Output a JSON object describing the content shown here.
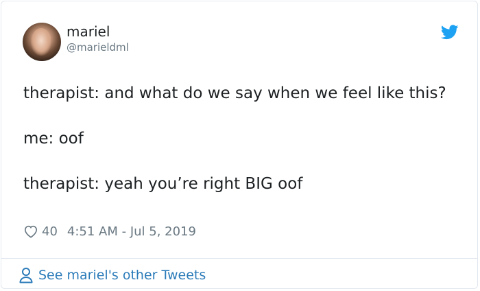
{
  "author": {
    "name": "mariel",
    "handle": "@marieldml"
  },
  "tweet": {
    "paragraphs": [
      "therapist: and what do we say when we feel like this?",
      "me: oof",
      "therapist: yeah you’re right BIG oof"
    ],
    "like_count": "40",
    "timestamp": "4:51 AM - Jul 5, 2019"
  },
  "footer": {
    "link_label": "See mariel's other Tweets"
  },
  "icons": {
    "logo": "twitter-bird-icon",
    "like": "heart-icon",
    "profile": "person-icon"
  },
  "colors": {
    "text": "#1c2022",
    "muted": "#697882",
    "link": "#2b7bb9",
    "brand": "#1da1f2",
    "border": "#e1e8ed"
  }
}
